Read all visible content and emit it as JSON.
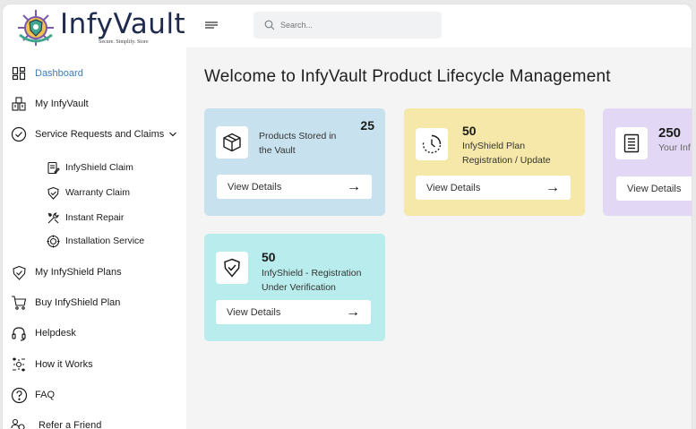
{
  "brand": {
    "name": "InfyVault",
    "tagline": "Secure. Simplify. Store"
  },
  "search": {
    "placeholder": "Search..."
  },
  "sidebar": {
    "items": [
      {
        "label": "Dashboard",
        "icon": "dashboard-icon",
        "active": true
      },
      {
        "label": "My InfyVault",
        "icon": "vault-icon"
      },
      {
        "label": "Service Requests and Claims",
        "icon": "check-circle-icon",
        "expanded": true
      },
      {
        "label": "InfyShield Claim",
        "icon": "claim-icon"
      },
      {
        "label": "Warranty Claim",
        "icon": "shield-check-icon"
      },
      {
        "label": "Instant Repair",
        "icon": "tools-icon"
      },
      {
        "label": "Installation Service",
        "icon": "installation-icon"
      },
      {
        "label": "My InfyShield Plans",
        "icon": "shield-plans-icon"
      },
      {
        "label": "Buy InfyShield Plan",
        "icon": "cart-icon"
      },
      {
        "label": "Helpdesk",
        "icon": "headset-icon"
      },
      {
        "label": "How it Works",
        "icon": "settings-flow-icon"
      },
      {
        "label": "FAQ",
        "icon": "question-icon"
      },
      {
        "label": "Refer a Friend",
        "icon": "refer-icon"
      }
    ]
  },
  "main": {
    "welcome": "Welcome to InfyVault Product Lifecycle Management",
    "cards": [
      {
        "number": "25",
        "desc_line1": "Products Stored in",
        "desc_line2": "the Vault",
        "button": "View Details",
        "color": "#c7e2ee",
        "icon": "box-icon"
      },
      {
        "number": "50",
        "desc_line1": "InfyShield Plan",
        "desc_line2": "Registration / Update",
        "button": "View Details",
        "color": "#f6e8a8",
        "icon": "clock-icon"
      },
      {
        "number": "250",
        "desc_line1": "Your Inf",
        "desc_line2": "",
        "button": "View Details",
        "color": "#e2d8f5",
        "icon": "document-list-icon"
      },
      {
        "number": "50",
        "desc_line1": "InfyShield - Registration",
        "desc_line2": "Under Verification",
        "button": "View Details",
        "color": "#b9ecec",
        "icon": "shield-verified-icon"
      }
    ],
    "arrow": "→"
  },
  "colors": {
    "accent": "#3a7bbd",
    "brand_dark": "#1f2b4d",
    "main_bg": "#f4f4f5"
  }
}
